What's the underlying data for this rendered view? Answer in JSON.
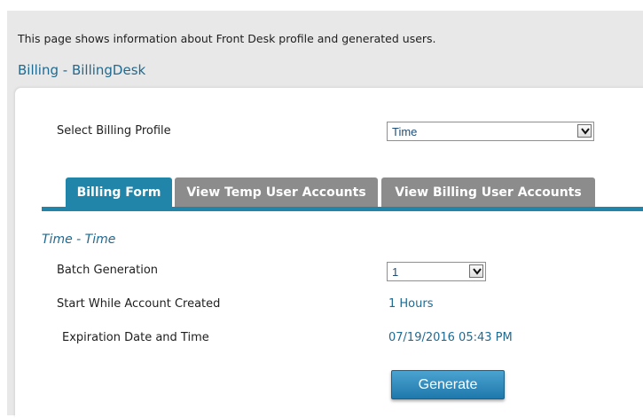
{
  "intro_text": "This page shows information about Front Desk profile and generated users.",
  "page_title": "Billing - BillingDesk",
  "profile_select": {
    "label": "Select Billing Profile",
    "value": "Time"
  },
  "tabs": [
    {
      "label": "Billing Form",
      "active": true
    },
    {
      "label": "View Temp User Accounts",
      "active": false
    },
    {
      "label": "View Billing User Accounts",
      "active": false
    }
  ],
  "form": {
    "section_title": "Time - Time",
    "batch_generation": {
      "label": "Batch Generation",
      "value": "1"
    },
    "start_while_account_created": {
      "label": "Start While Account Created",
      "value": "1 Hours"
    },
    "expiration": {
      "label": "Expiration Date and Time",
      "value": "07/19/2016 05:43 PM"
    },
    "generate_label": "Generate"
  },
  "colors": {
    "accent": "#2185a9",
    "link_text": "#1f6a91",
    "inactive_tab": "#8c8c8c"
  }
}
